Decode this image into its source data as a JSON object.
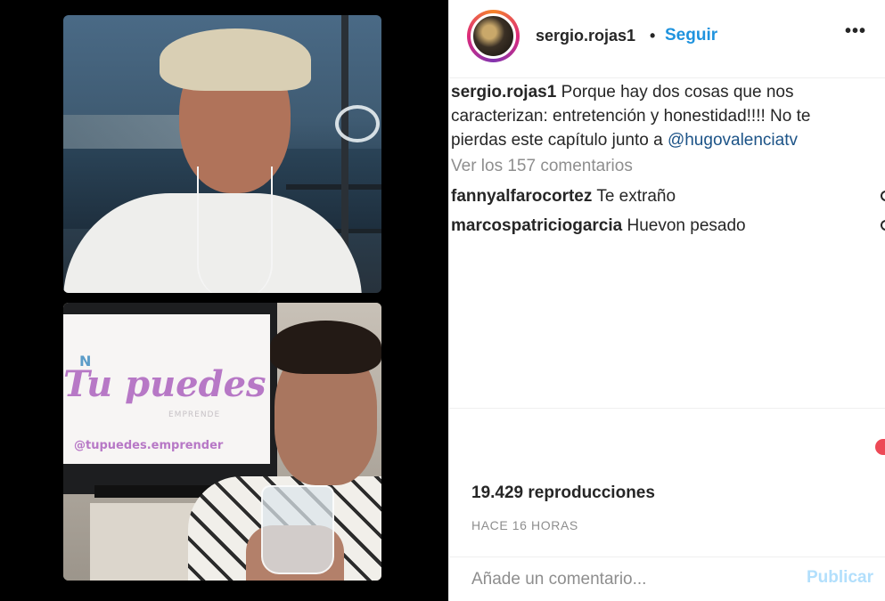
{
  "media": {
    "tv": {
      "logo_letter": "N",
      "title": "Tu puedes",
      "subtitle": "EMPRENDE",
      "handle": "@tupuedes.emprender"
    }
  },
  "post": {
    "username": "sergio.rojas1",
    "separator": "•",
    "follow_label": "Seguir",
    "more_label": "•••",
    "caption": {
      "user": "sergio.rojas1",
      "text": "Porque hay dos cosas que nos caracterizan: entretención y honestidad!!!! No te pierdas este capítulo junto a",
      "mention": "@hugovalenciatv"
    },
    "view_comments": "Ver los 157 comentarios",
    "comments": [
      {
        "user": "fannyalfarocortez",
        "text": "Te extraño"
      },
      {
        "user": "marcospatriciogarcia",
        "text": "Huevon pesado"
      }
    ],
    "views": "19.429 reproducciones",
    "time": "HACE 16 HORAS",
    "comment_placeholder": "Añade un comentario...",
    "publish_label": "Publicar"
  },
  "colors": {
    "follow": "#1f93de",
    "mention": "#1c5387",
    "publish_disabled": "#b2dffc",
    "muted": "#8e8e8e"
  }
}
